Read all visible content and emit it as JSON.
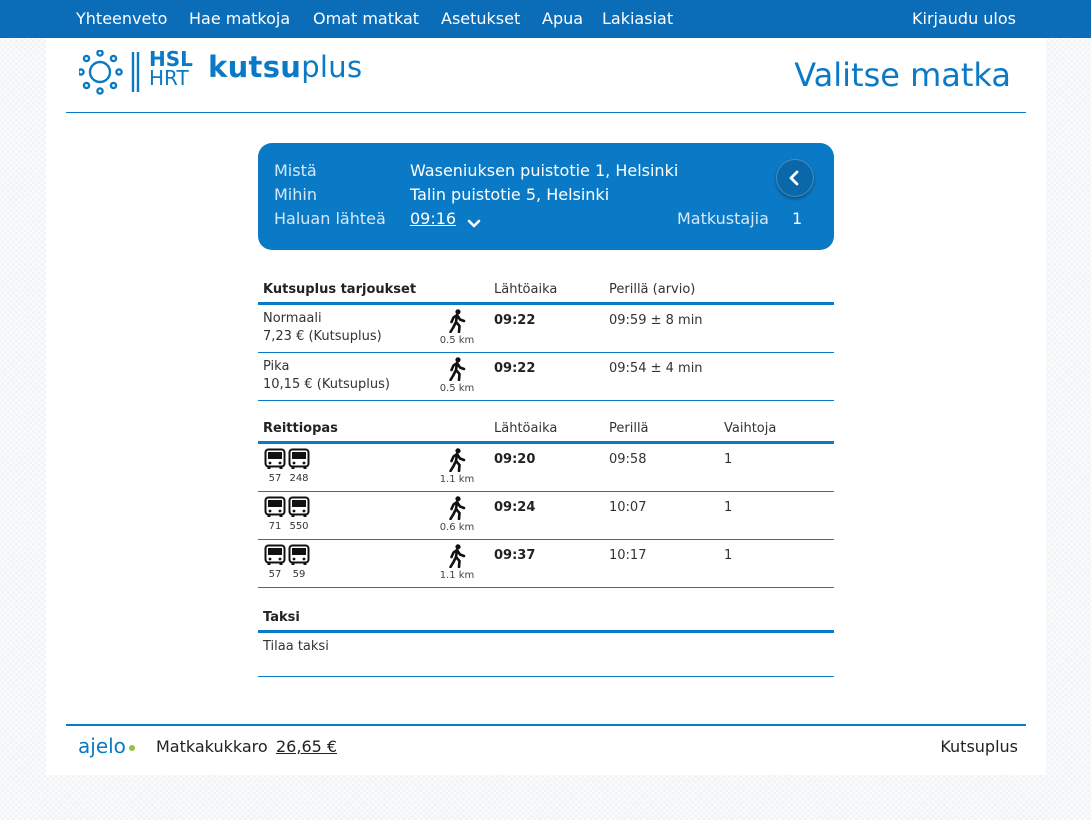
{
  "nav": {
    "items": [
      "Yhteenveto",
      "Hae matkoja",
      "Omat matkat",
      "Asetukset",
      "Apua",
      "Lakiasiat"
    ],
    "logout": "Kirjaudu ulos"
  },
  "logo": {
    "brand_top": "HSL",
    "brand_bottom": "HRT",
    "product_bold": "kutsu",
    "product_light": "plus"
  },
  "page_title": "Valitse matka",
  "trip": {
    "from_label": "Mistä",
    "from_value": "Waseniuksen puistotie 1, Helsinki",
    "to_label": "Mihin",
    "to_value": "Talin puistotie 5, Helsinki",
    "depart_label": "Haluan lähteä",
    "depart_value": "09:16",
    "passengers_label": "Matkustajia",
    "passengers_value": "1"
  },
  "kutsuplus": {
    "title": "Kutsuplus tarjoukset",
    "col_depart": "Lähtöaika",
    "col_arrive": "Perillä (arvio)",
    "rows": [
      {
        "name": "Normaali",
        "price": "7,23 € (Kutsuplus)",
        "walk": "0.5 km",
        "depart": "09:22",
        "arrive": "09:59 ± 8 min"
      },
      {
        "name": "Pika",
        "price": "10,15 € (Kutsuplus)",
        "walk": "0.5 km",
        "depart": "09:22",
        "arrive": "09:54 ± 4 min"
      }
    ]
  },
  "reittiopas": {
    "title": "Reittiopas",
    "col_depart": "Lähtöaika",
    "col_arrive": "Perillä",
    "col_transfers": "Vaihtoja",
    "rows": [
      {
        "lines": [
          "57",
          "248"
        ],
        "walk": "1.1 km",
        "depart": "09:20",
        "arrive": "09:58",
        "transfers": "1"
      },
      {
        "lines": [
          "71",
          "550"
        ],
        "walk": "0.6 km",
        "depart": "09:24",
        "arrive": "10:07",
        "transfers": "1"
      },
      {
        "lines": [
          "57",
          "59"
        ],
        "walk": "1.1 km",
        "depart": "09:37",
        "arrive": "10:17",
        "transfers": "1"
      }
    ]
  },
  "taksi": {
    "title": "Taksi",
    "order_label": "Tilaa taksi"
  },
  "footer": {
    "ajelo": "ajelo",
    "wallet_label": "Matkakukkaro",
    "wallet_value": "26,65 €",
    "right": "Kutsuplus"
  },
  "icons": {
    "walk": "walking-person-icon",
    "bus": "bus-icon",
    "back": "chevron-left-icon",
    "dropdown": "chevron-down-icon"
  },
  "colors": {
    "brand": "#0b7ac6",
    "nav": "#0b6cb8",
    "accent": "#8dc63f"
  }
}
